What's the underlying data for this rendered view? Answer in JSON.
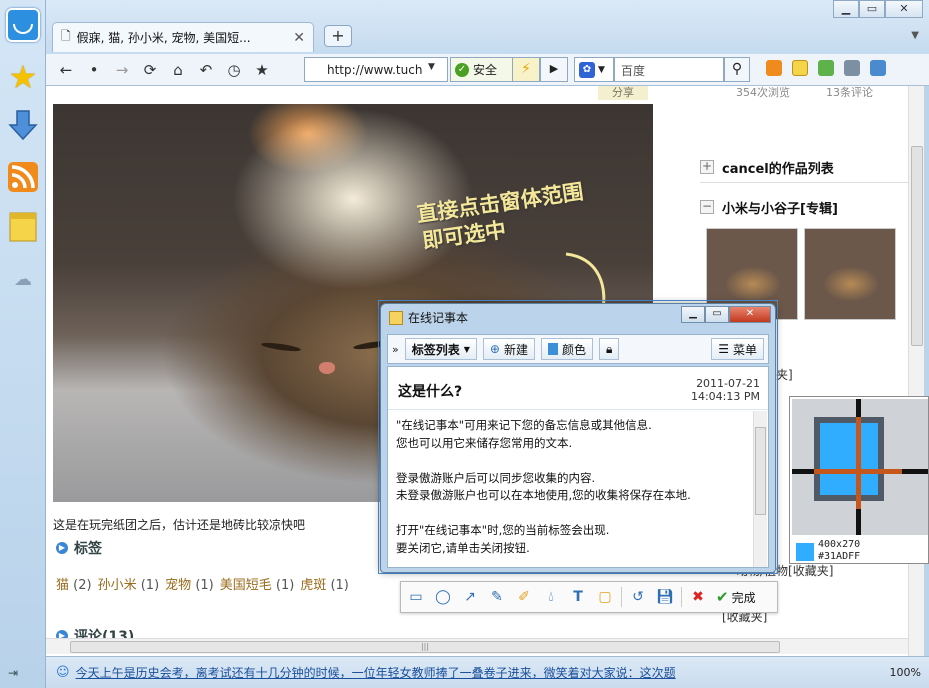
{
  "tab": {
    "title": "假寐, 猫, 孙小米, 宠物, 美国短..."
  },
  "toolbar": {
    "address": "http://www.tuch",
    "safe_label": "安全",
    "search_placeholder": "百度"
  },
  "page": {
    "share": "分享",
    "views": "354次浏览",
    "comments": "13条评论",
    "caption": "这是在玩完纸团之后，估计还是地砖比较凉快吧",
    "tags_heading": "标签",
    "tags": [
      {
        "name": "猫",
        "count": "(2)"
      },
      {
        "name": "孙小米",
        "count": "(1)"
      },
      {
        "name": "宠物",
        "count": "(1)"
      },
      {
        "name": "美国短毛",
        "count": "(1)"
      },
      {
        "name": "虎斑",
        "count": "(1)"
      }
    ],
    "comments_heading": "评论(13)"
  },
  "right_panel": {
    "item1": "cancel的作品列表",
    "item2": "小米与小谷子[专辑]",
    "folder1": "夹]",
    "folder2": "[收藏夹]",
    "folder3": "动物/植物[收藏夹]",
    "folder4": "[收藏夹]"
  },
  "annotation": {
    "line1": "直接点击窗体范围",
    "line2": "即可选中"
  },
  "notepad": {
    "window_title": "在线记事本",
    "list_label": "标签列表",
    "new_label": "新建",
    "color_label": "颜色",
    "menu_label": "菜单",
    "note_title": "这是什么?",
    "note_date": "2011-07-21",
    "note_time": "14:04:13 PM",
    "lines": [
      "\"在线记事本\"可用来记下您的备忘信息或其他信息.",
      "您也可以用它来储存您常用的文本.",
      "",
      "登录傲游账户后可以同步您收集的内容.",
      "未登录傲游账户也可以在本地使用,您的收集将保存在本地.",
      "",
      "打开\"在线记事本\"时,您的当前标签会出现.",
      "要关闭它,请单击关闭按钮."
    ]
  },
  "captool": {
    "done_label": "完成"
  },
  "magnifier": {
    "size": "400x270",
    "color": "#31ADFF"
  },
  "statusbar": {
    "text": "今天上午是历史会考，离考试还有十几分钟的时候，一位年轻女教师捧了一叠卷子进来，微笑着对大家说：这次题",
    "zoom": "100%"
  }
}
